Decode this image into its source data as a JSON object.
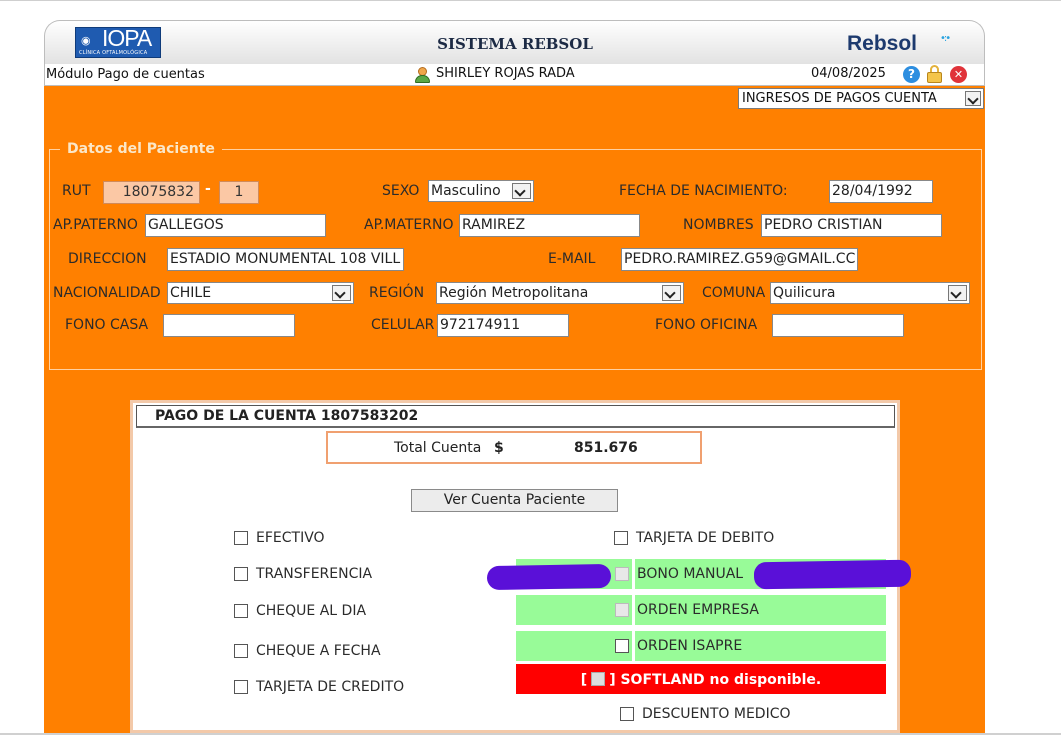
{
  "header": {
    "logo_text": "IOPA",
    "logo_subtext": "CLÍNICA OFTALMOLÓGICA",
    "system_title": "SISTEMA REBSOL",
    "brand": "Rebsol",
    "module": "Módulo Pago de cuentas",
    "user": "SHIRLEY ROJAS RADA",
    "date": "04/08/2025",
    "icons": [
      "help-icon",
      "lock-icon",
      "close-icon"
    ]
  },
  "section_select": {
    "value": "INGRESOS DE PAGOS CUENTA"
  },
  "patient": {
    "legend": "Datos del Paciente",
    "rut_label": "RUT",
    "rut": "18075832",
    "rut_sep": "-",
    "rut_dv": "1",
    "sexo_label": "SEXO",
    "sexo": "Masculino",
    "fecha_label": "FECHA DE NACIMIENTO:",
    "fecha": "28/04/1992",
    "ap_paterno_label": "AP.PATERNO",
    "ap_paterno": "GALLEGOS",
    "ap_materno_label": "AP.MATERNO",
    "ap_materno": "RAMIREZ",
    "nombres_label": "NOMBRES",
    "nombres": "PEDRO CRISTIAN",
    "direccion_label": "DIRECCION",
    "direccion": "ESTADIO MONUMENTAL 108 VILL",
    "email_label": "E-MAIL",
    "email": "PEDRO.RAMIREZ.G59@GMAIL.CC",
    "nacionalidad_label": "NACIONALIDAD",
    "nacionalidad": "CHILE",
    "region_label": "REGIÓN",
    "region": "Región Metropolitana",
    "comuna_label": "COMUNA",
    "comuna": "Quilicura",
    "fono_casa_label": "FONO CASA",
    "fono_casa": "",
    "celular_label": "CELULAR",
    "celular": "972174911",
    "fono_oficina_label": "FONO OFICINA",
    "fono_oficina": ""
  },
  "payment": {
    "title": "PAGO DE LA CUENTA  1807583202",
    "total_label": "Total Cuenta",
    "currency": "$",
    "total": "851.676",
    "view_button": "Ver Cuenta Paciente",
    "left_options": [
      "EFECTIVO",
      "TRANSFERENCIA",
      "CHEQUE AL DIA",
      "CHEQUE A FECHA",
      "TARJETA DE CREDITO"
    ],
    "right_options": {
      "debito": "TARJETA DE DEBITO",
      "bono": "BONO MANUAL",
      "orden_empresa": "ORDEN EMPRESA",
      "orden_isapre": "ORDEN ISAPRE",
      "softland_open": "[",
      "softland_close": "] SOFTLAND no disponible.",
      "descuento": "DESCUENTO MEDICO"
    },
    "colors": {
      "green": "#98fb98",
      "red": "#ff0000",
      "orange": "#ff8000"
    }
  }
}
